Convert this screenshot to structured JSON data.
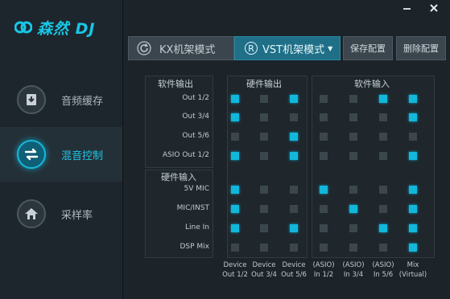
{
  "app": {
    "logo_text": "森然 DJ"
  },
  "window": {
    "minimize_icon": "minimize-icon",
    "close_icon": "close-icon"
  },
  "sidebar": {
    "items": [
      {
        "label": "音频缓存",
        "icon": "download-icon",
        "active": false
      },
      {
        "label": "混音控制",
        "icon": "swap-arrows-icon",
        "active": true
      },
      {
        "label": "采样率",
        "icon": "home-icon",
        "active": false
      }
    ]
  },
  "tabs": {
    "kx": "KX机架模式",
    "vst": "VST机架模式",
    "vst_badge": "R"
  },
  "buttons": {
    "save": "保存配置",
    "delete": "删除配置"
  },
  "matrix": {
    "sections": {
      "software_output": "软件输出",
      "hardware_output": "硬件输出",
      "software_input": "软件输入",
      "hardware_input": "硬件输入"
    },
    "rows": [
      "Out 1/2",
      "Out 3/4",
      "Out 5/6",
      "ASIO Out 1/2",
      "5V MIC",
      "MIC/INST",
      "Line In",
      "DSP Mix"
    ],
    "columns": [
      [
        "Device",
        "Out 1/2"
      ],
      [
        "Device",
        "Out 3/4"
      ],
      [
        "Device",
        "Out 5/6"
      ],
      [
        "(ASIO)",
        "In 1/2"
      ],
      [
        "(ASIO)",
        "In 3/4"
      ],
      [
        "(ASIO)",
        "In 5/6"
      ],
      [
        "Mix",
        "(Virtual)"
      ]
    ],
    "routing": [
      [
        1,
        0,
        1,
        0,
        0,
        1,
        1
      ],
      [
        1,
        0,
        0,
        0,
        0,
        0,
        1
      ],
      [
        0,
        0,
        1,
        0,
        0,
        0,
        0
      ],
      [
        1,
        0,
        1,
        0,
        0,
        0,
        1
      ],
      [
        1,
        0,
        0,
        1,
        0,
        0,
        1
      ],
      [
        1,
        0,
        0,
        0,
        1,
        0,
        1
      ],
      [
        1,
        0,
        1,
        0,
        0,
        1,
        1
      ],
      [
        0,
        0,
        0,
        0,
        0,
        0,
        1
      ]
    ]
  },
  "colors": {
    "accent": "#12b7da",
    "cell_off": "#3c464d",
    "background": "#1c2329"
  }
}
